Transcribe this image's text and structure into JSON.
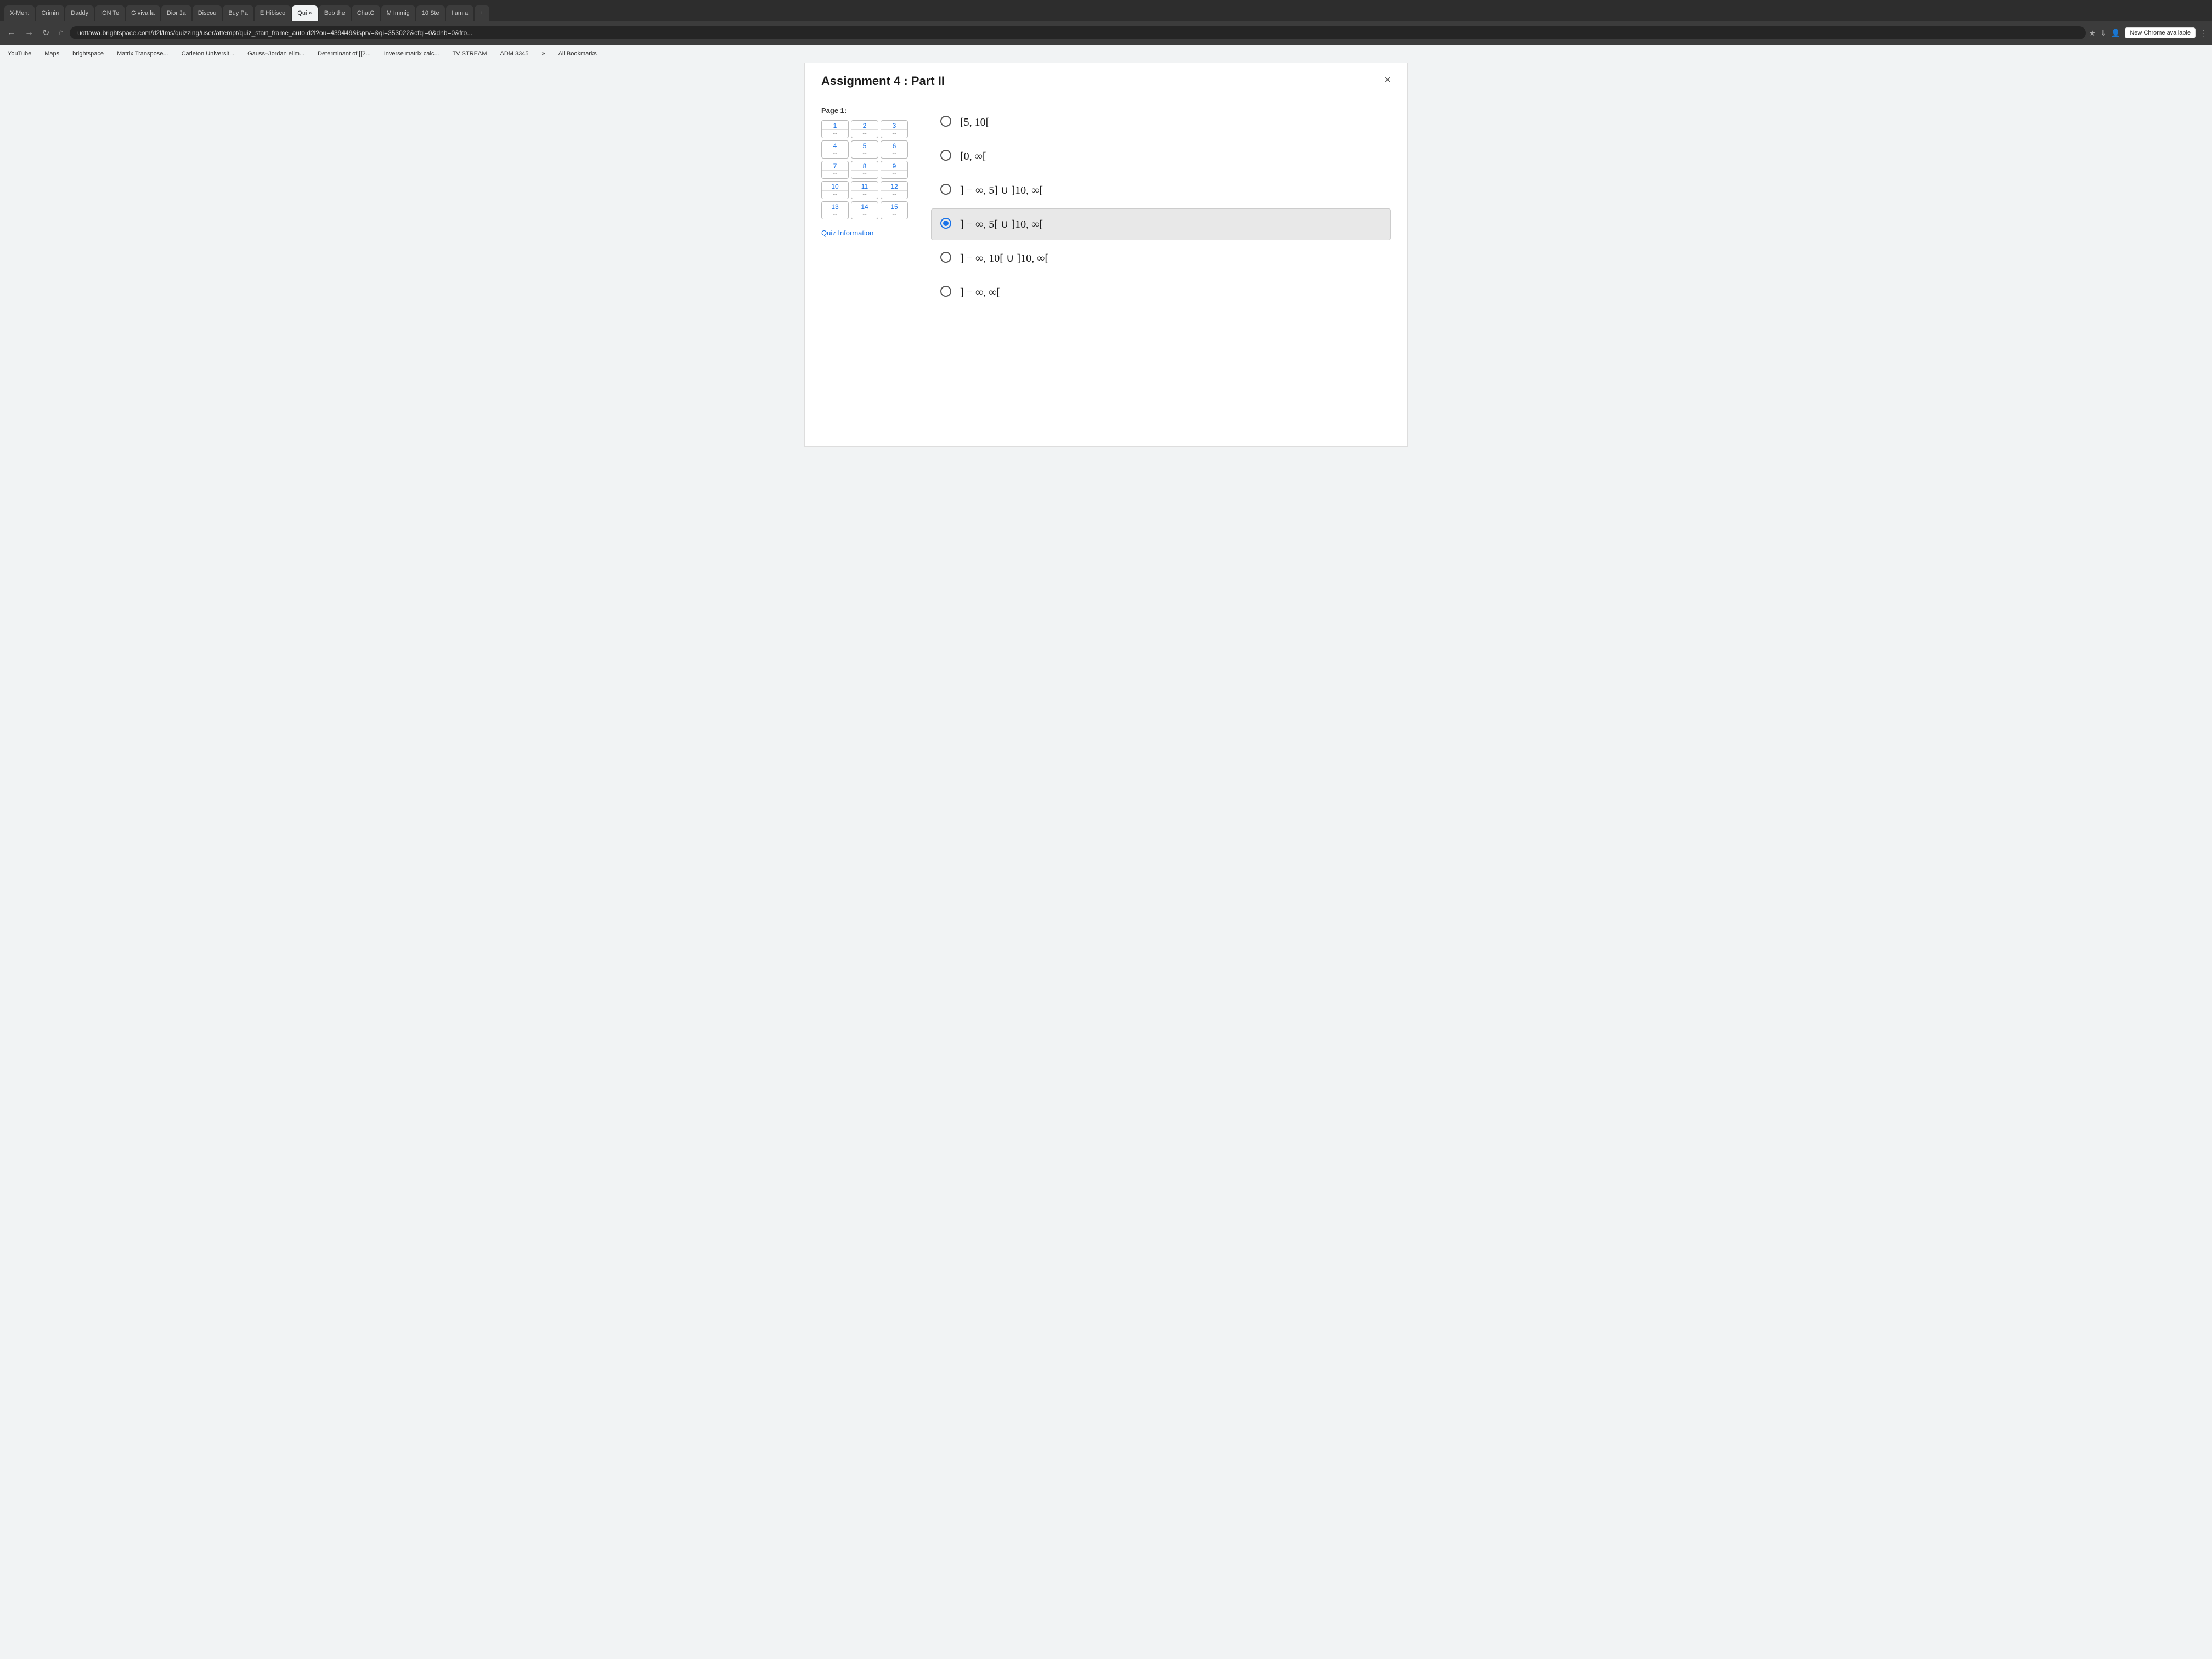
{
  "browser": {
    "tabs": [
      {
        "label": "X-Men:",
        "active": false
      },
      {
        "label": "Crimin",
        "active": false
      },
      {
        "label": "Daddy",
        "active": false
      },
      {
        "label": "ION Te",
        "active": false
      },
      {
        "label": "G viva la",
        "active": false
      },
      {
        "label": "Dior Ja",
        "active": false
      },
      {
        "label": "Discou",
        "active": false
      },
      {
        "label": "Buy Pa",
        "active": false
      },
      {
        "label": "E Hibisco",
        "active": false
      },
      {
        "label": "Qui ×",
        "active": true
      },
      {
        "label": "Bob the",
        "active": false
      },
      {
        "label": "ChatG",
        "active": false
      },
      {
        "label": "M Immig",
        "active": false
      },
      {
        "label": "10 Ste",
        "active": false
      },
      {
        "label": "I am a",
        "active": false
      },
      {
        "label": "+",
        "active": false
      }
    ],
    "address": "uottawa.brightspace.com/d2l/lms/quizzing/user/attempt/quiz_start_frame_auto.d2l?ou=439449&isprv=&qi=353022&cfql=0&dnb=0&fro...",
    "new_chrome_label": "New Chrome available",
    "bookmarks": [
      "YouTube",
      "Maps",
      "brightspace",
      "Matrix Transpose...",
      "Carleton Universit...",
      "Gauss–Jordan elim...",
      "Determinant of [[2...",
      "Inverse matrix calc...",
      "TV STREAM",
      "ADM 3345",
      "»",
      "All Bookmarks"
    ]
  },
  "quiz": {
    "title": "Assignment 4 : Part II",
    "page_label": "Page 1:",
    "close_button": "×",
    "questions": [
      {
        "num": 1,
        "score": "--"
      },
      {
        "num": 2,
        "score": "--"
      },
      {
        "num": 3,
        "score": "--"
      },
      {
        "num": 4,
        "score": "--"
      },
      {
        "num": 5,
        "score": "--"
      },
      {
        "num": 6,
        "score": "--"
      },
      {
        "num": 7,
        "score": "--"
      },
      {
        "num": 8,
        "score": "--"
      },
      {
        "num": 9,
        "score": "--"
      },
      {
        "num": 10,
        "score": "--"
      },
      {
        "num": 11,
        "score": "--"
      },
      {
        "num": 12,
        "score": "--"
      },
      {
        "num": 13,
        "score": "--"
      },
      {
        "num": 14,
        "score": "--"
      },
      {
        "num": 15,
        "score": "--"
      }
    ],
    "quiz_info_label": "Quiz Information",
    "options": [
      {
        "id": 1,
        "text": "[5, 10[",
        "selected": false,
        "checked": false
      },
      {
        "id": 2,
        "text": "[0, ∞[",
        "selected": false,
        "checked": false
      },
      {
        "id": 3,
        "text": "] − ∞, 5] ∪ ]10, ∞[",
        "selected": false,
        "checked": false
      },
      {
        "id": 4,
        "text": "] − ∞, 5[ ∪ ]10, ∞[",
        "selected": true,
        "checked": true
      },
      {
        "id": 5,
        "text": "] − ∞, 10[ ∪ ]10, ∞[",
        "selected": false,
        "checked": false
      },
      {
        "id": 6,
        "text": "] − ∞, ∞[",
        "selected": false,
        "checked": false
      }
    ]
  }
}
